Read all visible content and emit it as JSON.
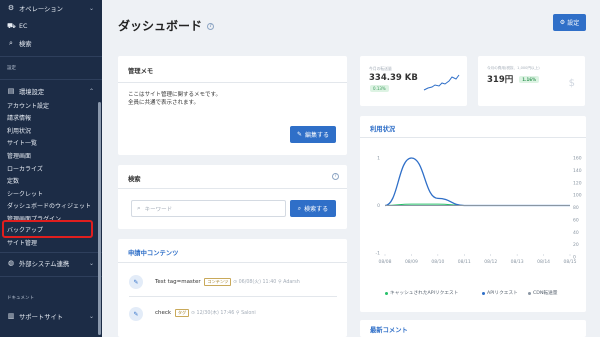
{
  "sidebar": {
    "top_items": [
      {
        "label": "オペレーション",
        "icon": "gear-icon"
      },
      {
        "label": "EC",
        "icon": "cart-icon"
      },
      {
        "label": "検索",
        "icon": "search-icon"
      }
    ],
    "section_settings": "設定",
    "env_settings": "環境設定",
    "sub_items": [
      "アカウント設定",
      "請求情報",
      "利用状況",
      "サイト一覧",
      "管理画面",
      "ローカライズ",
      "定数",
      "シークレット",
      "ダッシュボードのウィジェット",
      "管理画面プラグイン",
      "バックアップ",
      "サイト管理"
    ],
    "external": "外部システム連携",
    "section_docs": "ドキュメント",
    "support": "サポートサイト"
  },
  "header": {
    "title": "ダッシュボード",
    "help": "?",
    "settings_button": "設定"
  },
  "memo": {
    "title": "管理メモ",
    "line1": "ここはサイト管理に関するメモです。",
    "line2": "全員に共通で表示されます。",
    "edit_button": "編集する"
  },
  "search": {
    "title": "検索",
    "help": "?",
    "placeholder": "キーワード",
    "button": "検索する"
  },
  "contents": {
    "title": "申請中コンテンツ",
    "items": [
      {
        "name": "Test tag=master",
        "tag": "コンテンツ",
        "date": "06/08(火) 11:40",
        "user": "Adarsh"
      },
      {
        "name": "check",
        "tag": "タグ",
        "date": "12/30(木) 17:46",
        "user": "Saloni"
      }
    ]
  },
  "stats": {
    "traffic_label": "今月の転送量",
    "traffic_value": "334.39 KB",
    "traffic_pct": "0.13%",
    "cost_label": "今月の費用(税抜、1,000円以上)",
    "cost_value": "319円",
    "cost_pct": "1.16%",
    "currency": "$"
  },
  "usage": {
    "title": "利用状況",
    "legend": [
      "キャッシュされたAPIリクエスト",
      "APIリクエスト",
      "CDN転送量"
    ]
  },
  "recent": {
    "title": "最新コメント"
  },
  "colors": {
    "sidebar_bg": "#1c2c46",
    "primary": "#2f6fc8",
    "highlight": "#e01e1e",
    "cached_series": "#27c06a",
    "api_series": "#2f6fc8",
    "cdn_series": "#8a96a3"
  },
  "chart_data": {
    "type": "line",
    "x": [
      "08/08",
      "08/09",
      "08/10",
      "08/11",
      "08/12",
      "08/13",
      "08/14",
      "08/15"
    ],
    "y_left_ticks": [
      "1",
      "0",
      "-1"
    ],
    "y_right_ticks": [
      "160",
      "140",
      "120",
      "100",
      "80",
      "60",
      "40",
      "20",
      "0"
    ],
    "series": [
      {
        "name": "キャッシュされたAPIリクエスト",
        "values": [
          0,
          0.03,
          0.03,
          0,
          0,
          0,
          0,
          0
        ]
      },
      {
        "name": "APIリクエスト",
        "values": [
          0,
          1,
          0.15,
          0,
          0,
          0,
          0,
          0
        ]
      },
      {
        "name": "CDN転送量",
        "values": [
          0,
          0,
          0,
          0,
          0,
          0,
          0,
          0
        ]
      }
    ]
  }
}
